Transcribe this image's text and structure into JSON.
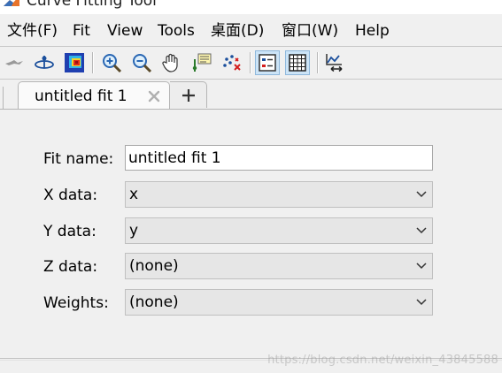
{
  "window": {
    "title": "Curve Fitting Tool",
    "logo_icon": "matlab-logo-icon"
  },
  "menu": [
    {
      "label": "文件(F)"
    },
    {
      "label": "Fit"
    },
    {
      "label": "View"
    },
    {
      "label": "Tools"
    },
    {
      "label": "桌面(D)"
    },
    {
      "label": "窗口(W)"
    },
    {
      "label": "Help"
    }
  ],
  "toolbar": {
    "buttons": [
      {
        "icon": "auto-fit-icon"
      },
      {
        "icon": "main-plot-icon"
      },
      {
        "icon": "surface-plot-icon"
      },
      {
        "icon": "zoom-in-icon"
      },
      {
        "icon": "zoom-out-icon"
      },
      {
        "icon": "pan-hand-icon"
      },
      {
        "icon": "data-cursor-icon"
      },
      {
        "icon": "exclude-outliers-icon"
      },
      {
        "icon": "legend-icon"
      },
      {
        "icon": "grid-icon"
      },
      {
        "icon": "axes-limits-icon"
      }
    ]
  },
  "tabs": {
    "active_label": "untitled fit 1",
    "add_symbol": "+"
  },
  "form": {
    "fit_name": {
      "label": "Fit name:",
      "value": "untitled fit 1"
    },
    "x_data": {
      "label": "X data:",
      "value": "x"
    },
    "y_data": {
      "label": "Y data:",
      "value": "y"
    },
    "z_data": {
      "label": "Z data:",
      "value": "(none)"
    },
    "weights": {
      "label": "Weights:",
      "value": "(none)"
    }
  },
  "watermark": "https://blog.csdn.net/weixin_43845588"
}
